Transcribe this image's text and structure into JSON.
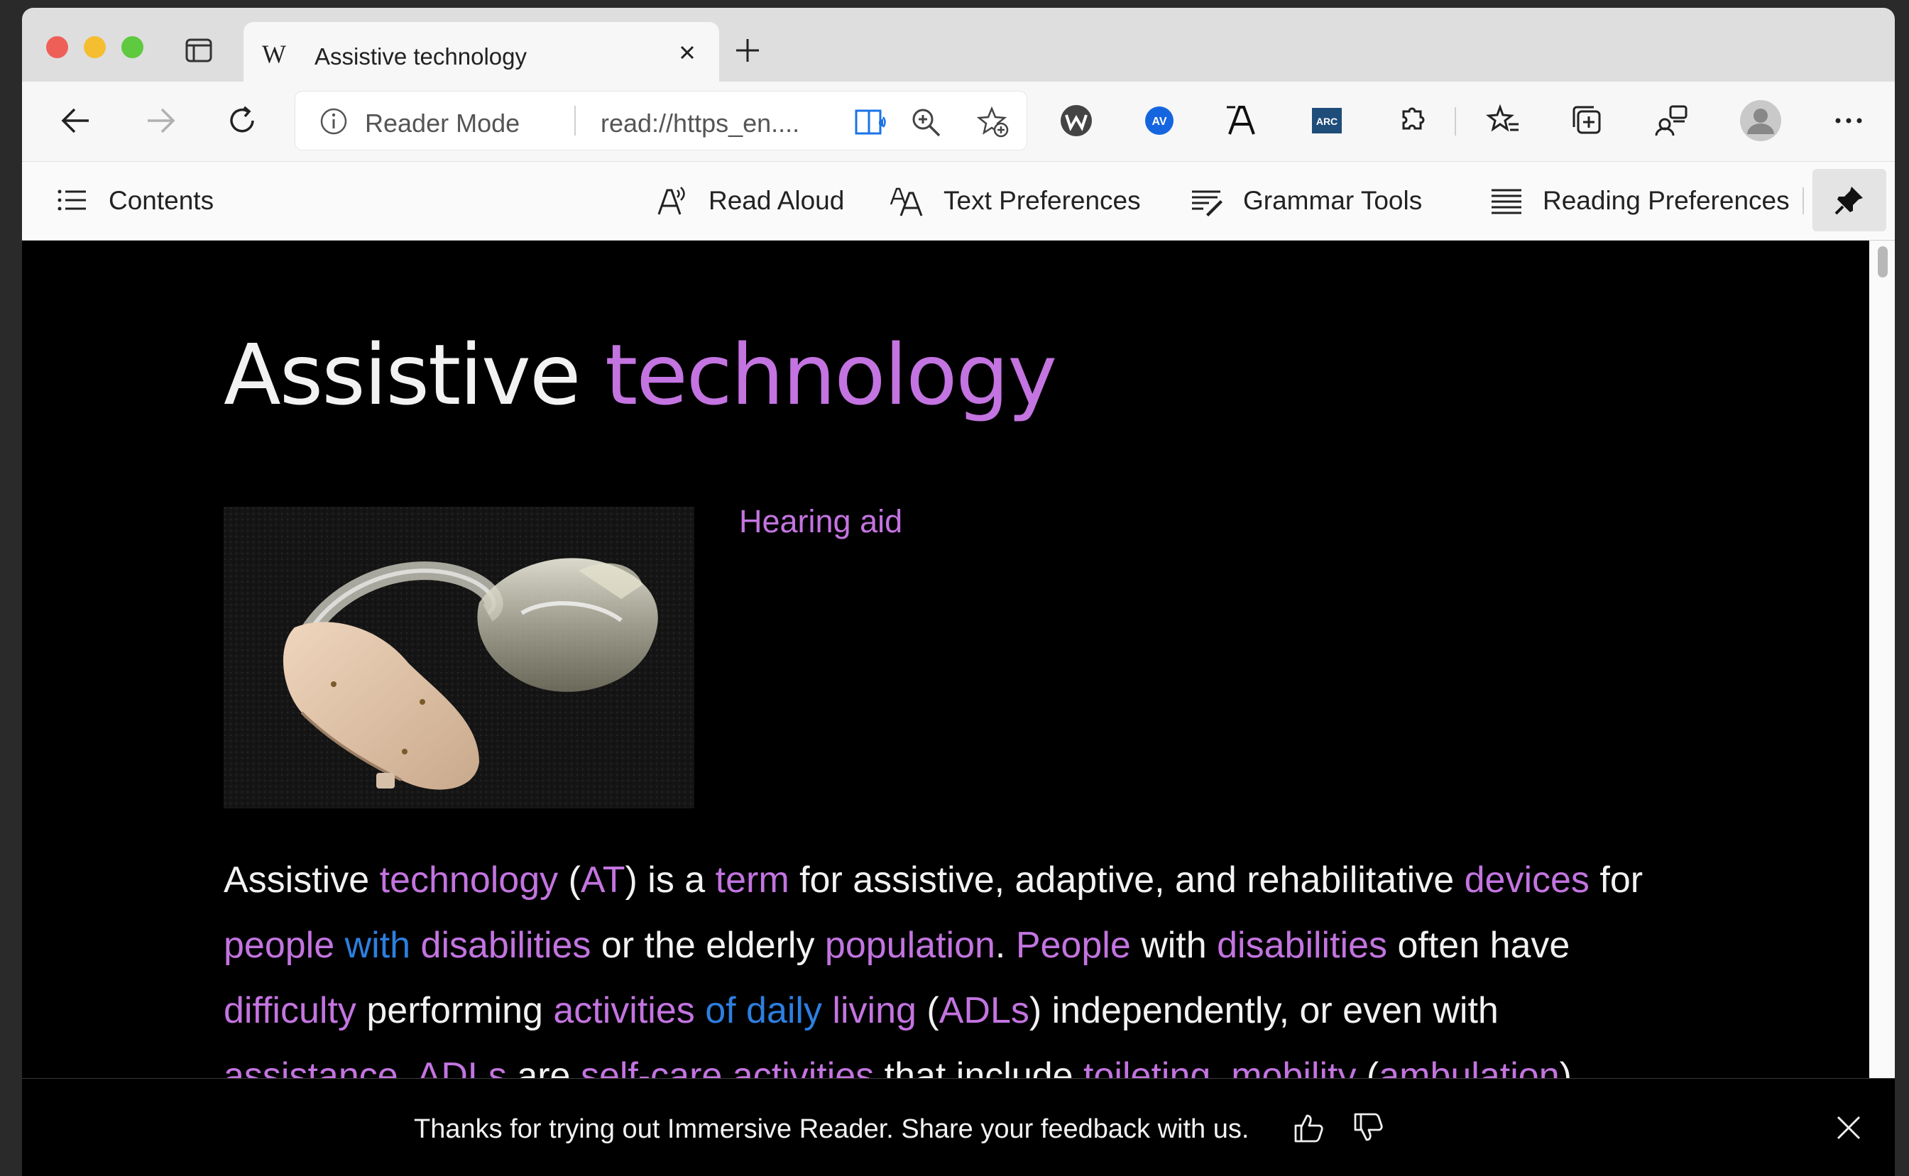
{
  "tab": {
    "favicon": "W",
    "title": "Assistive technology"
  },
  "address_bar": {
    "mode": "Reader Mode",
    "url": "read://https_en...."
  },
  "reader_toolbar": {
    "contents": "Contents",
    "read_aloud": "Read Aloud",
    "text_preferences": "Text Preferences",
    "grammar_tools": "Grammar Tools",
    "reading_preferences": "Reading Preferences"
  },
  "article": {
    "title_part1": "Assistive ",
    "title_part2": "technology",
    "image_caption": "Hearing aid",
    "paragraph": [
      [
        {
          "t": "Assistive "
        },
        {
          "t": "technology",
          "c": "pink"
        },
        {
          "t": " ("
        },
        {
          "t": "AT",
          "c": "pink"
        },
        {
          "t": ") is a "
        },
        {
          "t": "term",
          "c": "pink"
        },
        {
          "t": " for assistive, adaptive, and rehabilitative "
        },
        {
          "t": "devices",
          "c": "pink"
        },
        {
          "t": " for"
        }
      ],
      [
        {
          "t": "people",
          "c": "pink"
        },
        {
          "t": " with",
          "c": "blue"
        },
        {
          "t": " disabilities",
          "c": "pink"
        },
        {
          "t": " or the elderly "
        },
        {
          "t": "population",
          "c": "pink"
        },
        {
          "t": ". "
        },
        {
          "t": "People",
          "c": "pink"
        },
        {
          "t": " with "
        },
        {
          "t": "disabilities",
          "c": "pink"
        },
        {
          "t": " often have"
        }
      ],
      [
        {
          "t": "difficulty",
          "c": "pink"
        },
        {
          "t": " performing "
        },
        {
          "t": "activities",
          "c": "pink"
        },
        {
          "t": " of daily",
          "c": "blue"
        },
        {
          "t": " living",
          "c": "pink"
        },
        {
          "t": " ("
        },
        {
          "t": "ADLs",
          "c": "pink"
        },
        {
          "t": ") independently, or even with"
        }
      ],
      [
        {
          "t": "assistance",
          "c": "pink"
        },
        {
          "t": ". "
        },
        {
          "t": "ADLs",
          "c": "pink"
        },
        {
          "t": " are "
        },
        {
          "t": "self-care activities",
          "c": "pink"
        },
        {
          "t": " that include "
        },
        {
          "t": "toileting",
          "c": "pink"
        },
        {
          "t": ", "
        },
        {
          "t": "mobility",
          "c": "pink"
        },
        {
          "t": " ("
        },
        {
          "t": "ambulation",
          "c": "pink"
        },
        {
          "t": ")"
        }
      ]
    ]
  },
  "feedback_bar": {
    "message": "Thanks for trying out Immersive Reader. Share your feedback with us."
  },
  "colors": {
    "accent_pink": "#c374e0",
    "accent_blue": "#2d7fe0",
    "background": "#000000",
    "text": "#f2f2f2"
  }
}
